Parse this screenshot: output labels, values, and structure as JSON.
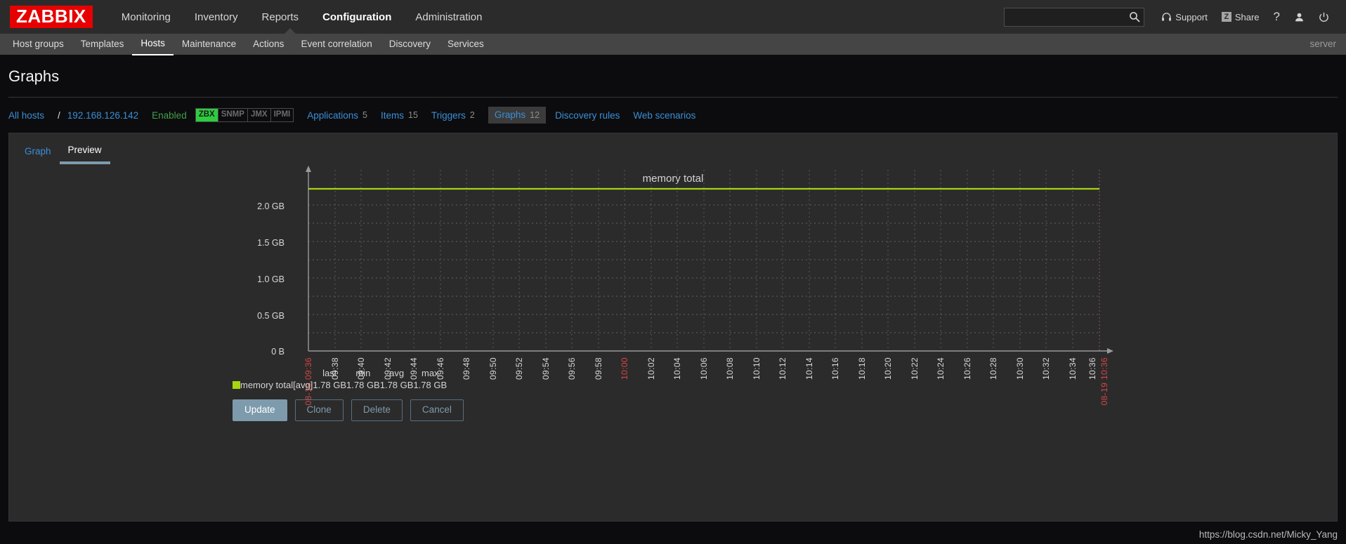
{
  "header": {
    "logo": "ZABBIX",
    "nav": [
      {
        "label": "Monitoring",
        "selected": false
      },
      {
        "label": "Inventory",
        "selected": false
      },
      {
        "label": "Reports",
        "selected": false
      },
      {
        "label": "Configuration",
        "selected": true
      },
      {
        "label": "Administration",
        "selected": false
      }
    ],
    "search": {
      "value": "",
      "placeholder": "",
      "icon": "search-icon"
    },
    "support_label": "Support",
    "share_label": "Share",
    "share_badge": "Z",
    "help_label": "?",
    "user_icon": "user-icon",
    "signout_icon": "power-icon"
  },
  "subnav": {
    "items": [
      {
        "label": "Host groups",
        "selected": false
      },
      {
        "label": "Templates",
        "selected": false
      },
      {
        "label": "Hosts",
        "selected": true
      },
      {
        "label": "Maintenance",
        "selected": false
      },
      {
        "label": "Actions",
        "selected": false
      },
      {
        "label": "Event correlation",
        "selected": false
      },
      {
        "label": "Discovery",
        "selected": false
      },
      {
        "label": "Services",
        "selected": false
      }
    ],
    "server_label": "server"
  },
  "page": {
    "title": "Graphs"
  },
  "breadcrumb": {
    "all_hosts": "All hosts",
    "separator": "/",
    "host": "192.168.126.142",
    "status": "Enabled",
    "availability": [
      {
        "label": "ZBX",
        "active": true
      },
      {
        "label": "SNMP",
        "active": false
      },
      {
        "label": "JMX",
        "active": false
      },
      {
        "label": "IPMI",
        "active": false
      }
    ],
    "links": [
      {
        "label": "Applications",
        "count": "5",
        "selected": false
      },
      {
        "label": "Items",
        "count": "15",
        "selected": false
      },
      {
        "label": "Triggers",
        "count": "2",
        "selected": false
      },
      {
        "label": "Graphs",
        "count": "12",
        "selected": true
      },
      {
        "label": "Discovery rules",
        "count": "",
        "selected": false
      },
      {
        "label": "Web scenarios",
        "count": "",
        "selected": false
      }
    ]
  },
  "tabs": [
    {
      "label": "Graph",
      "active": false
    },
    {
      "label": "Preview",
      "active": true
    }
  ],
  "chart_data": {
    "type": "line",
    "title": "memory total",
    "xlabel": "",
    "ylabel": "",
    "ylim": [
      0,
      2147483648
    ],
    "ytick_labels": [
      "2.0 GB",
      "1.5 GB",
      "1.0 GB",
      "0.5 GB",
      "0 B"
    ],
    "ytick_values": [
      2147483648,
      1610612736,
      1073741824,
      536870912,
      0
    ],
    "grid": true,
    "legend_position": "bottom",
    "line_color": "#a5d610",
    "boundary_color": "#d64545",
    "x_start_label": "08-19 09:36",
    "x_end_label": "08-19 10:36",
    "xtick_labels": [
      "08-19 09:36",
      "09:38",
      "09:40",
      "09:42",
      "09:44",
      "09:46",
      "09:48",
      "09:50",
      "09:52",
      "09:54",
      "09:56",
      "09:58",
      "10:00",
      "10:02",
      "10:04",
      "10:06",
      "10:08",
      "10:10",
      "10:12",
      "10:14",
      "10:16",
      "10:18",
      "10:20",
      "10:22",
      "10:24",
      "10:26",
      "10:28",
      "10:30",
      "10:32",
      "10:34",
      "10:36",
      "08-19 10:36"
    ],
    "xtick_highlight": [
      true,
      false,
      false,
      false,
      false,
      false,
      false,
      false,
      false,
      false,
      false,
      false,
      true,
      false,
      false,
      false,
      false,
      false,
      false,
      false,
      false,
      false,
      false,
      false,
      false,
      false,
      false,
      false,
      false,
      false,
      false,
      true
    ],
    "series": [
      {
        "name": "memory total",
        "aggregate": "[avg]",
        "color": "#a5d610",
        "value": 1910533324,
        "value_label": "1.78 GB",
        "last": "1.78 GB",
        "min": "1.78 GB",
        "avg": "1.78 GB",
        "max": "1.78 GB"
      }
    ]
  },
  "legend": {
    "headers": [
      "last",
      "min",
      "avg",
      "max"
    ]
  },
  "buttons": [
    {
      "label": "Update",
      "style": "primary"
    },
    {
      "label": "Clone",
      "style": "ghost"
    },
    {
      "label": "Delete",
      "style": "ghost"
    },
    {
      "label": "Cancel",
      "style": "ghost"
    }
  ],
  "watermark": "https://blog.csdn.net/Micky_Yang"
}
